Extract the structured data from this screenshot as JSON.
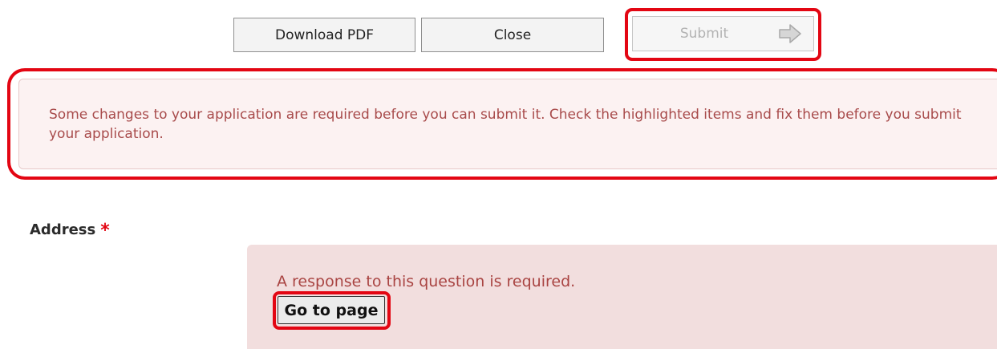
{
  "toolbar": {
    "download_label": "Download PDF",
    "close_label": "Close",
    "submit_label": "Submit",
    "submit_icon": "arrow-right-icon"
  },
  "alert": {
    "message": "Some changes to your application are required before you can submit it. Check the highlighted items and fix them before you submit your application."
  },
  "question": {
    "label": "Address",
    "required_marker": "*",
    "error_message": "A response to this question is required.",
    "goto_label": "Go to page"
  },
  "colors": {
    "highlight": "#e30613",
    "alert_text": "#a84b4b",
    "error_bg": "#f2dede"
  }
}
